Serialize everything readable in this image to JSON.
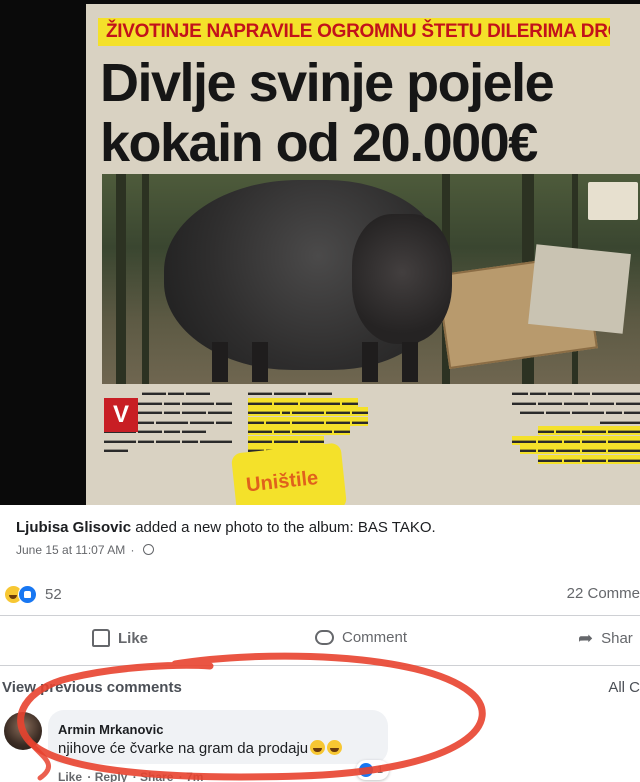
{
  "newspaper": {
    "kicker": "ŽIVOTINJE NAPRAVILE OGROMNU ŠTETU DILERIMA DROGE",
    "headline_line1": "Divlje svinje pojele",
    "headline_line2": "kokain od 20.000€",
    "dropcap": "V",
    "sticker": "Uništile"
  },
  "post": {
    "author": "Ljubisa Glisovic",
    "action_text": "added a new photo to the album:",
    "album": "BAS TAKO.",
    "date": "June 15 at 11:07 AM",
    "reactions_count": "52",
    "comments_count": "22 Comme",
    "like_label": "Like",
    "comment_label": "Comment",
    "share_label": "Shar",
    "view_previous": "View previous comments",
    "all_comments": "All C"
  },
  "comment": {
    "author": "Armin Mrkanovic",
    "text": "njihove će čvarke na gram da prodaju",
    "likes": "1",
    "like_label": "Like",
    "reply_label": "Reply",
    "share_label": "Share",
    "time": "7m"
  },
  "colors": {
    "facebook_blue": "#1877f2",
    "kicker_yellow": "#f4e12a",
    "headline_red": "#c2121b",
    "scribble_red": "#e8422f"
  }
}
